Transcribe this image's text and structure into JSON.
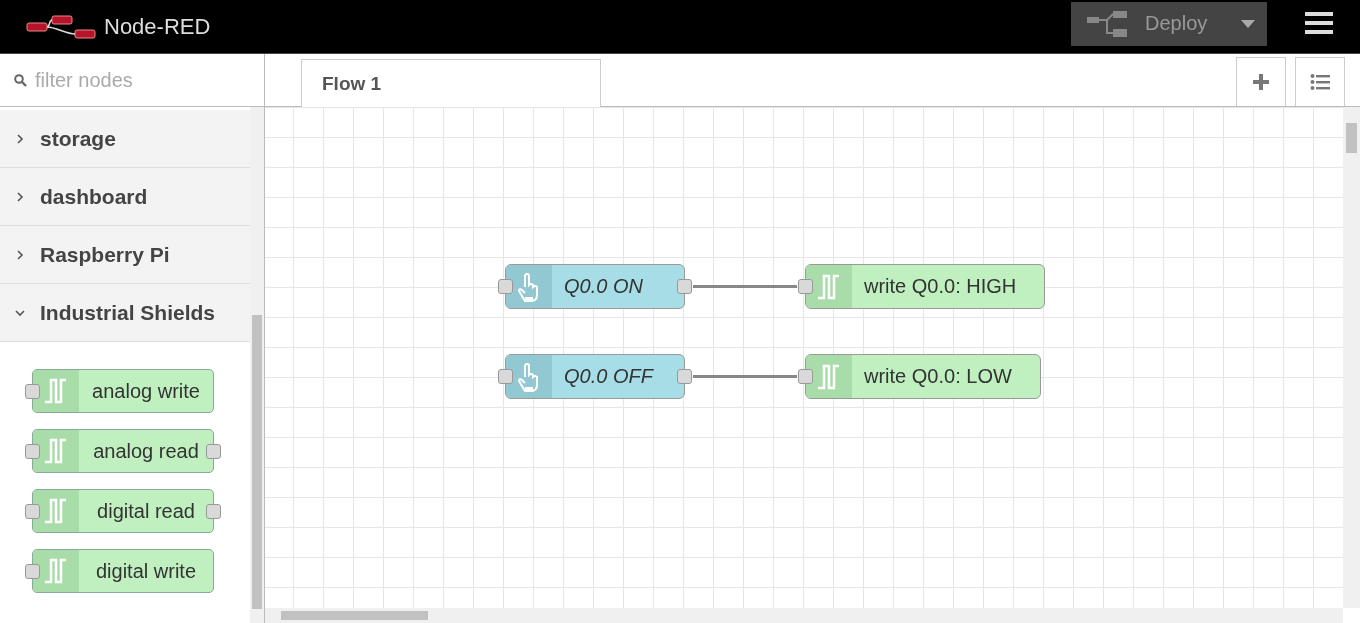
{
  "header": {
    "title": "Node-RED",
    "deploy": {
      "label": "Deploy"
    }
  },
  "palette": {
    "filter": {
      "placeholder": "filter nodes"
    },
    "categories": [
      {
        "label": "storage",
        "expanded": false
      },
      {
        "label": "dashboard",
        "expanded": false
      },
      {
        "label": "Raspberry Pi",
        "expanded": false
      },
      {
        "label": "Industrial Shields",
        "expanded": true
      }
    ],
    "nodes": [
      {
        "label": "analog write",
        "has_output": false
      },
      {
        "label": "analog read",
        "has_output": true
      },
      {
        "label": "digital read",
        "has_output": true
      },
      {
        "label": "digital write",
        "has_output": false
      }
    ]
  },
  "workspace": {
    "tabs": [
      {
        "label": "Flow 1",
        "selected": true
      }
    ],
    "flows": [
      {
        "source": {
          "label": "Q0.0 ON",
          "kind": "inject"
        },
        "target": {
          "label": "write Q0.0: HIGH",
          "kind": "output"
        }
      },
      {
        "source": {
          "label": "Q0.0 OFF",
          "kind": "inject"
        },
        "target": {
          "label": "write Q0.0: LOW",
          "kind": "output"
        }
      }
    ]
  }
}
